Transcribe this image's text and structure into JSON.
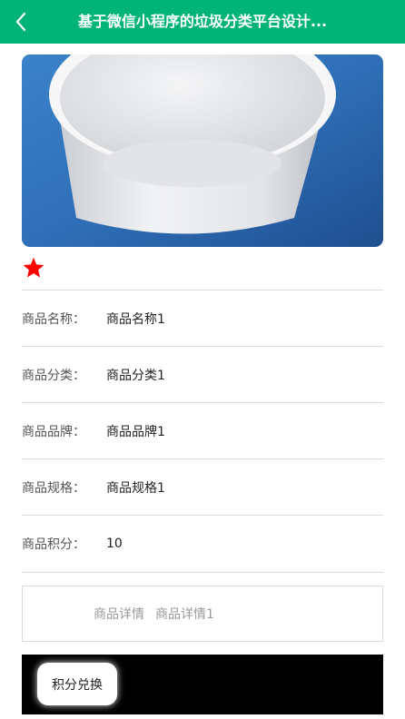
{
  "header": {
    "title": "基于微信小程序的垃圾分类平台设计...",
    "back_icon": "chevron-left-icon",
    "background_color": "#00b377"
  },
  "product": {
    "favorite_icon": "star-icon",
    "favorite_color": "#ff0000",
    "fields": [
      {
        "label": "商品名称：",
        "value": "商品名称1"
      },
      {
        "label": "商品分类：",
        "value": "商品分类1"
      },
      {
        "label": "商品品牌：",
        "value": "商品品牌1"
      },
      {
        "label": "商品规格：",
        "value": "商品规格1"
      },
      {
        "label": "商品积分：",
        "value": "10"
      }
    ],
    "detail": {
      "label": "商品详情",
      "value": "商品详情1"
    }
  },
  "actions": {
    "exchange_label": "积分兑换"
  }
}
